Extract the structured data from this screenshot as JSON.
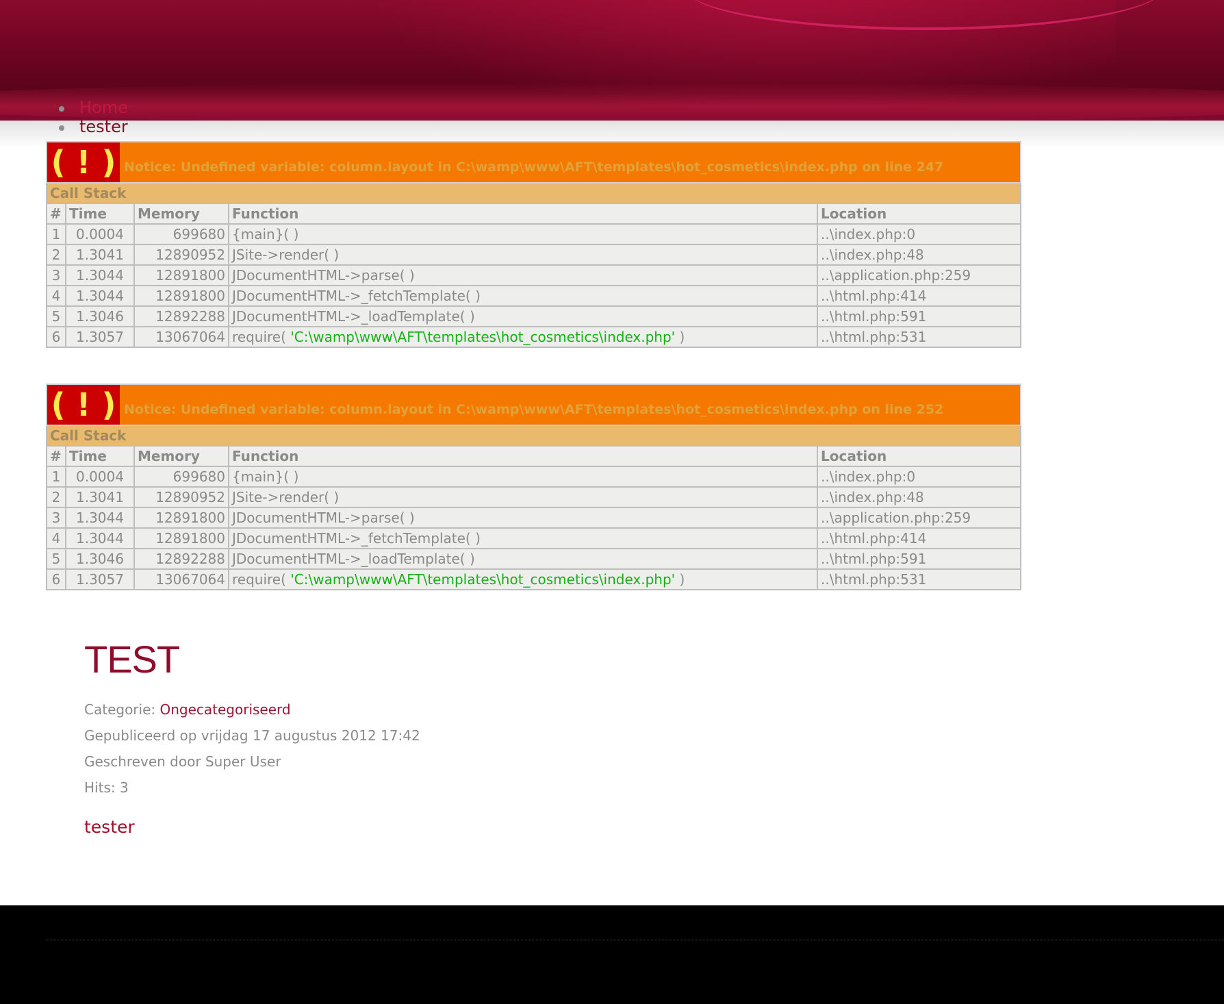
{
  "nav": {
    "items": [
      {
        "label": "Home"
      },
      {
        "label": "tester"
      }
    ]
  },
  "errors": [
    {
      "icon": "( ! )",
      "message": "Notice: Undefined variable: column.layout in C:\\wamp\\www\\AFT\\templates\\hot_cosmetics\\index.php on line 247",
      "callstack_label": "Call Stack",
      "headers": [
        "#",
        "Time",
        "Memory",
        "Function",
        "Location"
      ],
      "rows": [
        {
          "num": "1",
          "time": "0.0004",
          "memory": "699680",
          "func": "{main}( )",
          "func_arg": "",
          "func_close": "",
          "location": "..\\index.php:0"
        },
        {
          "num": "2",
          "time": "1.3041",
          "memory": "12890952",
          "func": "JSite->render( )",
          "func_arg": "",
          "func_close": "",
          "location": "..\\index.php:48"
        },
        {
          "num": "3",
          "time": "1.3044",
          "memory": "12891800",
          "func": "JDocumentHTML->parse( )",
          "func_arg": "",
          "func_close": "",
          "location": "..\\application.php:259"
        },
        {
          "num": "4",
          "time": "1.3044",
          "memory": "12891800",
          "func": "JDocumentHTML->_fetchTemplate( )",
          "func_arg": "",
          "func_close": "",
          "location": "..\\html.php:414"
        },
        {
          "num": "5",
          "time": "1.3046",
          "memory": "12892288",
          "func": "JDocumentHTML->_loadTemplate( )",
          "func_arg": "",
          "func_close": "",
          "location": "..\\html.php:591"
        },
        {
          "num": "6",
          "time": "1.3057",
          "memory": "13067064",
          "func": "require( ",
          "func_arg": "'C:\\wamp\\www\\AFT\\templates\\hot_cosmetics\\index.php'",
          "func_close": " )",
          "location": "..\\html.php:531"
        }
      ]
    },
    {
      "icon": "( ! )",
      "message": "Notice: Undefined variable: column.layout in C:\\wamp\\www\\AFT\\templates\\hot_cosmetics\\index.php on line 252",
      "callstack_label": "Call Stack",
      "headers": [
        "#",
        "Time",
        "Memory",
        "Function",
        "Location"
      ],
      "rows": [
        {
          "num": "1",
          "time": "0.0004",
          "memory": "699680",
          "func": "{main}( )",
          "func_arg": "",
          "func_close": "",
          "location": "..\\index.php:0"
        },
        {
          "num": "2",
          "time": "1.3041",
          "memory": "12890952",
          "func": "JSite->render( )",
          "func_arg": "",
          "func_close": "",
          "location": "..\\index.php:48"
        },
        {
          "num": "3",
          "time": "1.3044",
          "memory": "12891800",
          "func": "JDocumentHTML->parse( )",
          "func_arg": "",
          "func_close": "",
          "location": "..\\application.php:259"
        },
        {
          "num": "4",
          "time": "1.3044",
          "memory": "12891800",
          "func": "JDocumentHTML->_fetchTemplate( )",
          "func_arg": "",
          "func_close": "",
          "location": "..\\html.php:414"
        },
        {
          "num": "5",
          "time": "1.3046",
          "memory": "12892288",
          "func": "JDocumentHTML->_loadTemplate( )",
          "func_arg": "",
          "func_close": "",
          "location": "..\\html.php:591"
        },
        {
          "num": "6",
          "time": "1.3057",
          "memory": "13067064",
          "func": "require( ",
          "func_arg": "'C:\\wamp\\www\\AFT\\templates\\hot_cosmetics\\index.php'",
          "func_close": " )",
          "location": "..\\html.php:531"
        }
      ]
    }
  ],
  "article": {
    "title": "TEST",
    "category_label": "Categorie: ",
    "category_link": "Ongecategoriseerd",
    "published": "Gepubliceerd op vrijdag 17 augustus 2012 17:42",
    "author": "Geschreven door Super User",
    "hits": "Hits: 3",
    "body": "tester"
  },
  "colors": {
    "header": "#6c0522",
    "notice_bg": "#f57900",
    "icon_bg": "#cc0000",
    "callstack_bg": "#e9b96e",
    "link": "#9c1634",
    "footer": "#000000"
  }
}
